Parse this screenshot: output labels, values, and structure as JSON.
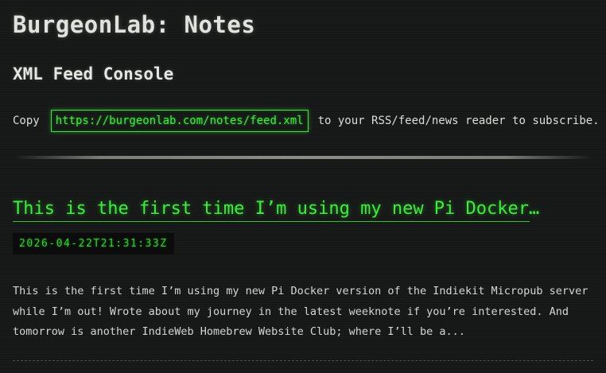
{
  "site": {
    "title": "BurgeonLab: Notes"
  },
  "console": {
    "heading": "XML Feed Console",
    "copy_prefix": "Copy",
    "feed_url": "https://burgeonlab.com/notes/feed.xml",
    "copy_suffix": "to your RSS/feed/news reader to subscribe."
  },
  "post": {
    "title": "This is the first time I’m using my new Pi Docker…",
    "date": "2026-04-22T21:31:33Z",
    "excerpt": "This is the first time I’m using my new Pi Docker version of the Indiekit Micropub server while I’m out! Wrote about my journey in the latest weeknote if you’re interested. And tomorrow is another IndieWeb Homebrew Website Club; where I’ll be a..."
  },
  "colors": {
    "background": "#161817",
    "accent_green": "#39f039",
    "text": "#d8dcd8"
  }
}
